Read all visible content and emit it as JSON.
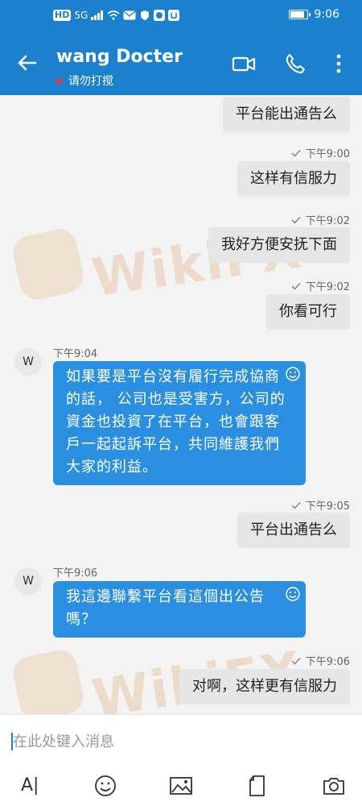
{
  "status_bar": {
    "icons_left": [
      "HD",
      "5G",
      "signal",
      "wifi",
      "mail",
      "shield",
      "app",
      "app2"
    ],
    "hd": "HD",
    "net": "5G",
    "battery_level": 0.8,
    "time": "9:06"
  },
  "header": {
    "title": "wang Docter",
    "subtitle": "请勿打搅",
    "status_color": "#e53935",
    "accent": "#1b80cd"
  },
  "messages": [
    {
      "direction": "out",
      "text": "平台能出通告么"
    },
    {
      "direction": "out",
      "time": "下午9:00",
      "text": "这样有信服力"
    },
    {
      "direction": "out",
      "time": "下午9:02",
      "text": "我好方便安抚下面"
    },
    {
      "direction": "out",
      "time": "下午9:02",
      "text": "你看可行"
    },
    {
      "direction": "in",
      "avatar": "W",
      "time": "下午9:04",
      "text": "如果要是平台沒有履行完成協商的話， 公司也是受害方，公司的資金也投資了在平台，也會跟客戶一起起訴平台，共同維護我們大家的利益。"
    },
    {
      "direction": "out",
      "time": "下午9:05",
      "text": "平台出通告么"
    },
    {
      "direction": "in",
      "avatar": "W",
      "time": "下午9:06",
      "text": "我這邊聯繫平台看這個出公告嗎？"
    },
    {
      "direction": "out",
      "time": "下午9:06",
      "text": "对啊，这样更有信服力"
    }
  ],
  "watermark": "WikiFX",
  "input": {
    "placeholder": "在此处键入消息",
    "value": ""
  },
  "toolbar": {
    "text_format_label": "A|",
    "icons": [
      "text-format-icon",
      "emoji-icon",
      "image-icon",
      "file-icon",
      "camera-icon"
    ]
  }
}
